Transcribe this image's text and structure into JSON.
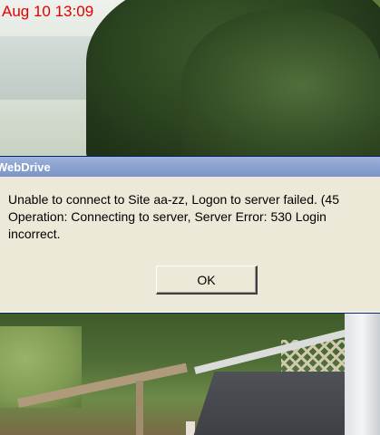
{
  "camera": {
    "timestamp": "Aug 10 13:09"
  },
  "dialog": {
    "title": "WebDrive",
    "message_lines": [
      "Unable to connect to Site aa-zz, Logon to server failed. (45",
      "Operation: Connecting to server, Server Error: 530 Login",
      "incorrect."
    ],
    "ok_label": "OK"
  },
  "colors": {
    "timestamp": "#e30000",
    "dialog_face": "#ece9d8",
    "titlebar": "#8aa2d0"
  }
}
